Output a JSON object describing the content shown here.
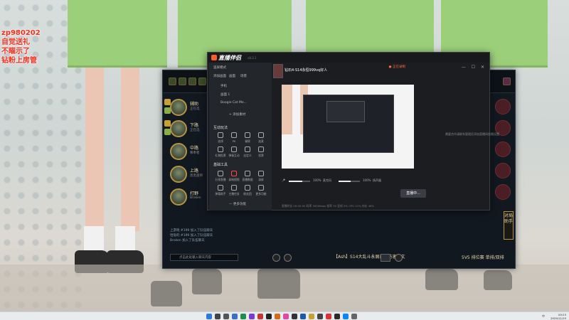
{
  "overlay": {
    "line1": "zp980202",
    "line2": "自觉送礼",
    "line3": "不瞄示了",
    "line4": "钻粉上房管"
  },
  "game": {
    "roster": [
      {
        "role": "辅助",
        "sub": "正在选"
      },
      {
        "role": "下路",
        "sub": "正在选"
      },
      {
        "role": "中路",
        "sub": "尊奉者"
      },
      {
        "role": "上路",
        "sub": "黑黑巫师"
      },
      {
        "role": "打野",
        "sub": "Broken"
      }
    ],
    "chat_lines": [
      "上游戏 #199 加入了队伍聊天",
      "恰饭的 #199 加入了队伍聊天",
      "Broken 加入了队伍聊天"
    ],
    "chat_placeholder": "点击此处输入聊天内容",
    "find_match_text": "【Ash】S14大乱斗永屑高，伤害符文",
    "mode_title": "5V5",
    "mode_sub": "排位赛 单排/双排",
    "side_button": "对局助手"
  },
  "stream": {
    "app_name": "直播伴侣",
    "version": "v8.3.1",
    "left": {
      "mode_label": "竖屏模式",
      "tabs": [
        "添加画面",
        "画面",
        "场景"
      ],
      "sources": [
        "手机",
        "画面 1",
        "Boogie Cat Me..."
      ],
      "add_source": "+ 添加素材",
      "section_interactive": "互动玩法",
      "interactive_tools": [
        "连线",
        "PK",
        "福袋",
        "连麦",
        "礼物投票",
        "弹幕互动",
        "自定义",
        "投票"
      ],
      "section_tools": "基础工具",
      "basic_tools": [
        "分享直播",
        "录制视频",
        "直播数据",
        "录屏",
        "弹幕助手",
        "主播任务",
        "粉丝团",
        "更多功能"
      ],
      "more": "— 更多功能"
    },
    "header": {
      "title_value": "钻石4-S14永恒999vq好人",
      "rec_label": "● 正在录制",
      "win_controls": "— ☐ ✕"
    },
    "right_info": "需要合作请联系管理员添加直播间权限设置",
    "controls": {
      "mic_label": "麦克风",
      "mic_value": "100%",
      "speaker_label": "扬声器",
      "speaker_value": "100%",
      "mic_level": 0.62,
      "speaker_level": 0.55,
      "live_button": "直播中..."
    },
    "stats": "直播时长 00:00:00  码率 3000kbps  帧率 30  丢帧 0%  CPU 12%  内存 46%"
  },
  "taskbar": {
    "tray": "中",
    "time": "00:23",
    "date": "2024/11/15"
  },
  "colors": {
    "overlay_red": "#ff2a1a",
    "gold": "#b59342",
    "record_orange": "#ff6a3a"
  }
}
